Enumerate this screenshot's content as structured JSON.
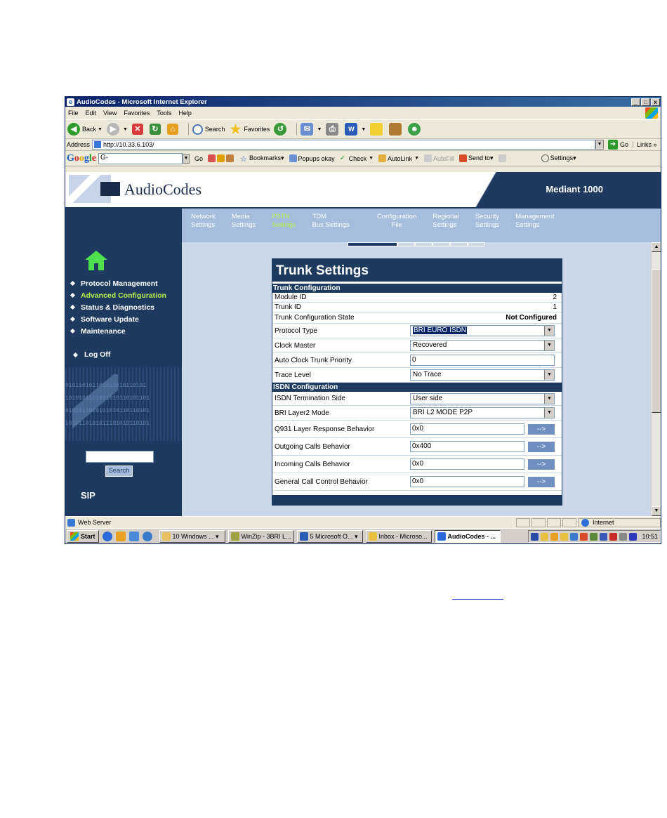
{
  "window": {
    "title": "AudioCodes - Microsoft Internet Explorer",
    "controls": [
      "_",
      "□",
      "x"
    ]
  },
  "menu": [
    "File",
    "Edit",
    "View",
    "Favorites",
    "Tools",
    "Help"
  ],
  "toolbar": {
    "back": "Back",
    "search": "Search",
    "favorites": "Favorites"
  },
  "address": {
    "label": "Address",
    "url": "http://10.33.6.103/",
    "go": "Go",
    "links": "Links »"
  },
  "googlebar": {
    "logo": "Google",
    "search_value": "G-",
    "go": "Go",
    "bookmarks": "Bookmarks▾",
    "popups": "Popups okay",
    "check": "Check",
    "autolink": "AutoLink",
    "autofill": "AutoFill",
    "sendto": "Send to▾",
    "settings": "Settings▾"
  },
  "banner": {
    "logo": "AudioCodes",
    "product": "Mediant 1000"
  },
  "nav": [
    {
      "line1": "Network",
      "line2": "Settings",
      "active": false
    },
    {
      "line1": "Media",
      "line2": "Settings",
      "active": false
    },
    {
      "line1": "PSTN",
      "line2": "Settings",
      "active": true
    },
    {
      "line1": "TDM",
      "line2": "Bus Settings",
      "active": false
    },
    {
      "line1": "Configuration",
      "line2": "File",
      "active": false
    },
    {
      "line1": "Regional",
      "line2": "Settings",
      "active": false
    },
    {
      "line1": "Security",
      "line2": "Settings",
      "active": false
    },
    {
      "line1": "Management",
      "line2": "Settings",
      "active": false
    }
  ],
  "sidebar": {
    "items": [
      {
        "label": "Protocol Management",
        "active": false
      },
      {
        "label": "Advanced Configuration",
        "active": true
      },
      {
        "label": "Status & Diagnostics",
        "active": false
      },
      {
        "label": "Software Update",
        "active": false
      },
      {
        "label": "Maintenance",
        "active": false
      }
    ],
    "logoff": "Log Off",
    "search_button": "Search",
    "protocol": "SIP",
    "binary_text": [
      "010110101101011010110101",
      "1010101101011010110101101",
      "0101011010101010110110101",
      "1010110101011101010110101"
    ]
  },
  "panel": {
    "title": "Trunk Settings",
    "trunk_configuration": {
      "heading": "Trunk Configuration",
      "module_id_label": "Module ID",
      "module_id_value": "2",
      "trunk_id_label": "Trunk ID",
      "trunk_id_value": "1",
      "state_label": "Trunk Configuration State",
      "state_value": "Not Configured",
      "protocol_type_label": "Protocol Type",
      "protocol_type_value": "BRI EURO ISDN",
      "clock_master_label": "Clock Master",
      "clock_master_value": "Recovered",
      "auto_clock_label": "Auto Clock Trunk Priority",
      "auto_clock_value": "0",
      "trace_level_label": "Trace Level",
      "trace_level_value": "No Trace"
    },
    "isdn_configuration": {
      "heading": "ISDN Configuration",
      "termination_side_label": "ISDN Termination Side",
      "termination_side_value": "User side",
      "layer2_mode_label": "BRI Layer2 Mode",
      "layer2_mode_value": "BRI L2 MODE P2P",
      "q931_label": "Q931 Layer Response Behavior",
      "q931_value": "0x0",
      "outgoing_label": "Outgoing Calls Behavior",
      "outgoing_value": "0x400",
      "incoming_label": "Incoming Calls Behavior",
      "incoming_value": "0x0",
      "general_label": "General Call Control Behavior",
      "general_value": "0x0",
      "arrow_label": "-->"
    }
  },
  "statusbar": {
    "text": "Web Server",
    "zone": "Internet"
  },
  "taskbar": {
    "start": "Start",
    "tasks": [
      {
        "label": "10 Windows ... ▾",
        "active": false
      },
      {
        "label": "WinZip - 3BRI L...",
        "active": false
      },
      {
        "label": "5 Microsoft O... ▾",
        "active": false
      },
      {
        "label": "Inbox - Microso...",
        "active": false
      },
      {
        "label": "AudioCodes - ...",
        "active": true
      }
    ],
    "clock": "10:51"
  }
}
